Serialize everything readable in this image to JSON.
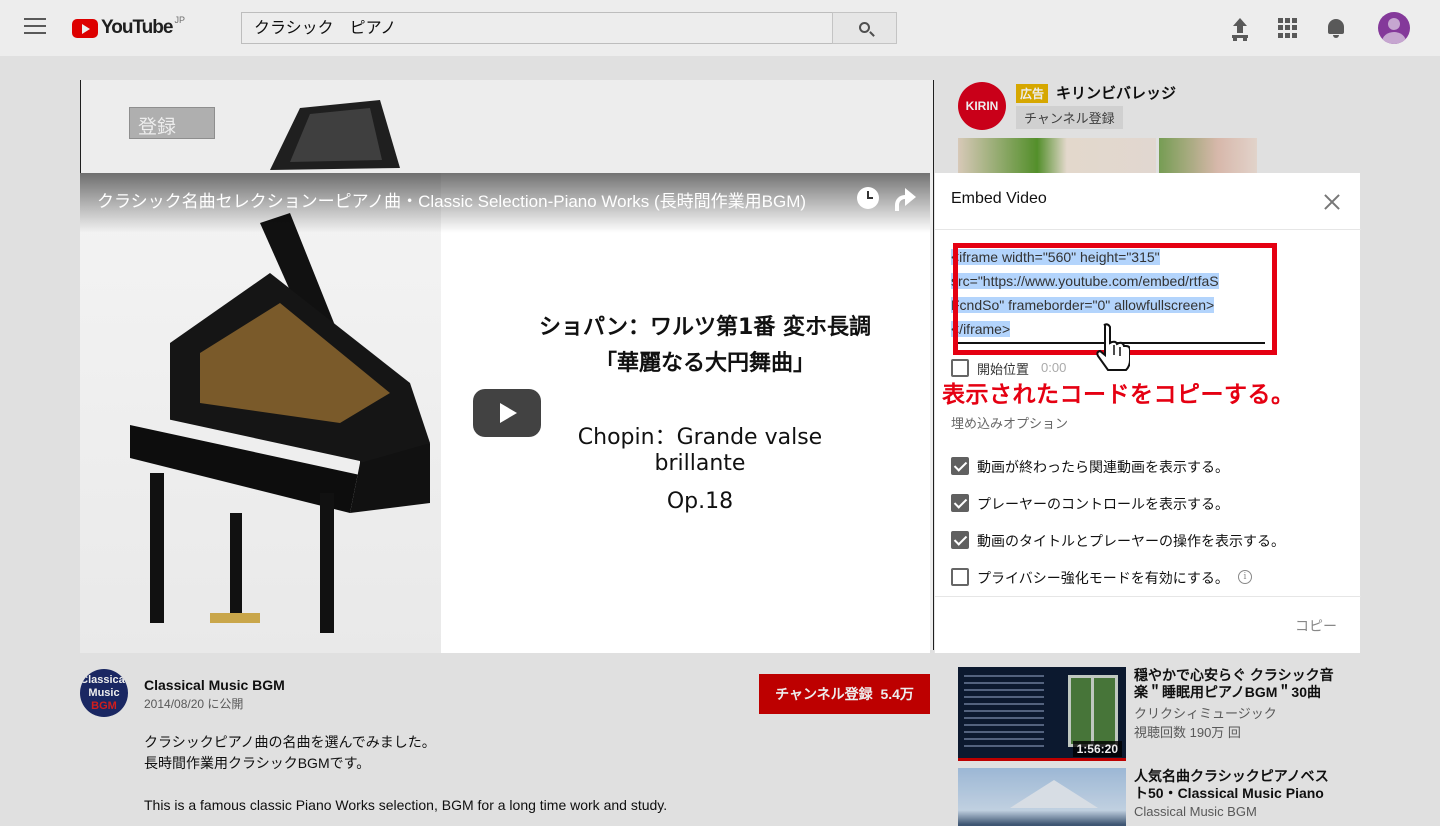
{
  "header": {
    "logo_text": "YouTube",
    "logo_region": "JP",
    "search_value": "クラシック　ピアノ",
    "icons": [
      "menu-icon",
      "search-icon",
      "upload-icon",
      "apps-icon",
      "bell-icon",
      "avatar"
    ]
  },
  "background_page": {
    "subscribe_label": "登録"
  },
  "ad": {
    "logo_text": "KIRIN",
    "badge": "広告",
    "name": "キリンビバレッジ",
    "subscribe_label": "チャンネル登録"
  },
  "player": {
    "title": "クラシック名曲セレクションーピアノ曲・Classic Selection-Piano Works (長時間作業用BGM)",
    "video_text": {
      "line1": "ショパン：ワルツ第1番 変ホ長調",
      "line2": "「華麗なる大円舞曲」",
      "line3": "Chopin：Grande valse brillante",
      "line4": "Op.18"
    }
  },
  "embed": {
    "title": "Embed Video",
    "code": "<iframe width=\"560\" height=\"315\" src=\"https://www.youtube.com/embed/rtfaSFcndSo\" frameborder=\"0\" allowfullscreen></iframe>",
    "code_lines": [
      "<iframe width=\"560\" height=\"315\"",
      "src=\"https://www.youtube.com/embed/rtfaS",
      "FcndSo\" frameborder=\"0\" allowfullscreen>",
      "</iframe>"
    ],
    "start_label": "開始位置",
    "start_time": "0:00",
    "annotation": "表示されたコードをコピーする。",
    "options_heading": "埋め込みオプション",
    "options": [
      {
        "label": "動画が終わったら関連動画を表示する。",
        "checked": true
      },
      {
        "label": "プレーヤーのコントロールを表示する。",
        "checked": true
      },
      {
        "label": "動画のタイトルとプレーヤーの操作を表示する。",
        "checked": true
      },
      {
        "label": "プライバシー強化モードを有効にする。",
        "checked": false
      }
    ],
    "copy_label": "コピー",
    "accent_color": "#e50012"
  },
  "channel": {
    "avatar_text_1": "Classical",
    "avatar_text_2": "Music",
    "avatar_text_3": "BGM",
    "name": "Classical Music BGM",
    "date": "2014/08/20 に公開",
    "subscribe_label": "チャンネル登録",
    "subscriber_count": "5.4万"
  },
  "description": {
    "line1": "クラシックピアノ曲の名曲を選んでみました。",
    "line2": "長時間作業用クラシックBGMです。",
    "line3": "This is a famous classic Piano Works selection, BGM for a long time work and study."
  },
  "recommendations": [
    {
      "title": "穏やかで心安らぐ クラシック音楽＂睡眠用ピアノBGM＂30曲",
      "channel": "クリクシィミュージック",
      "views": "視聴回数 190万 回",
      "duration": "1:56:20"
    },
    {
      "title": "人気名曲クラシックピアノベスト50・Classical Music Piano",
      "channel": "Classical Music BGM",
      "views": "",
      "duration": ""
    }
  ]
}
